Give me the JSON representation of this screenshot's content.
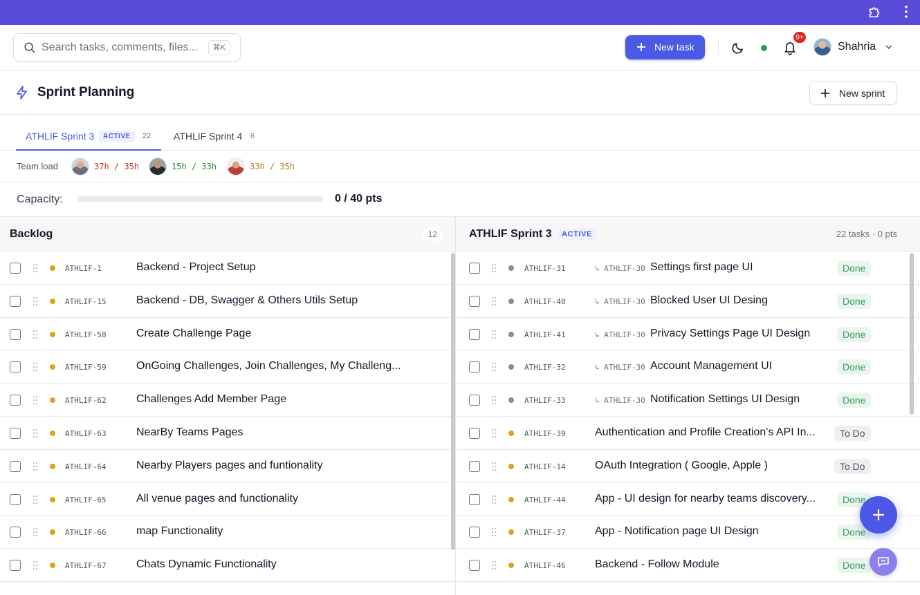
{
  "header": {
    "search_placeholder": "Search tasks, comments, files...",
    "search_shortcut": "⌘K",
    "new_task_label": "New task",
    "notifications_badge": "9+",
    "user_name": "Shahria"
  },
  "page": {
    "title": "Sprint Planning",
    "new_sprint_label": "New sprint"
  },
  "tabs": [
    {
      "label": "ATHLIF Sprint 3",
      "badge": "ACTIVE",
      "count": "22"
    },
    {
      "label": "ATHLIF Sprint 4",
      "count": "6"
    }
  ],
  "team_load": {
    "label": "Team load",
    "members": [
      {
        "load": "37h / 35h",
        "color": "#c0392b"
      },
      {
        "load": "15h / 33h",
        "color": "#2e8b3e"
      },
      {
        "load": "33h / 35h",
        "color": "#b7791f"
      }
    ]
  },
  "capacity": {
    "label": "Capacity:",
    "value": "0 / 40 pts",
    "fill_fraction": 0
  },
  "backlog": {
    "title": "Backlog",
    "count": "12",
    "rows": [
      {
        "id": "ATHLIF-1",
        "title": "Backend - Project Setup"
      },
      {
        "id": "ATHLIF-15",
        "title": "Backend - DB, Swagger & Others Utils Setup"
      },
      {
        "id": "ATHLIF-58",
        "title": "Create Challenge Page"
      },
      {
        "id": "ATHLIF-59",
        "title": "OnGoing Challenges, Join Challenges, My Challeng..."
      },
      {
        "id": "ATHLIF-62",
        "title": "Challenges Add Member Page"
      },
      {
        "id": "ATHLIF-63",
        "title": "NearBy Teams Pages"
      },
      {
        "id": "ATHLIF-64",
        "title": "Nearby Players pages and funtionality"
      },
      {
        "id": "ATHLIF-65",
        "title": "All venue pages and functionality"
      },
      {
        "id": "ATHLIF-66",
        "title": "map Functionality"
      },
      {
        "id": "ATHLIF-67",
        "title": "Chats Dynamic Functionality"
      }
    ]
  },
  "sprint": {
    "title": "ATHLIF Sprint 3",
    "badge": "ACTIVE",
    "meta": "22 tasks · 0 pts",
    "rows": [
      {
        "id": "ATHLIF-31",
        "parent": "↳ ATHLIF-30",
        "title": "Settings first page UI",
        "status": "Done",
        "dot": "#8a8d93"
      },
      {
        "id": "ATHLIF-40",
        "parent": "↳ ATHLIF-30",
        "title": "Blocked User UI Desing",
        "status": "Done",
        "dot": "#8a8d93"
      },
      {
        "id": "ATHLIF-41",
        "parent": "↳ ATHLIF-30",
        "title": "Privacy Settings Page UI Design",
        "status": "Done",
        "dot": "#8a8d93"
      },
      {
        "id": "ATHLIF-32",
        "parent": "↳ ATHLIF-30",
        "title": "Account Management UI",
        "status": "Done",
        "dot": "#8a8d93"
      },
      {
        "id": "ATHLIF-33",
        "parent": "↳ ATHLIF-30",
        "title": "Notification Settings UI Design",
        "status": "Done",
        "dot": "#8a8d93"
      },
      {
        "id": "ATHLIF-39",
        "parent": "",
        "title": "Authentication and Profile Creation's API In...",
        "status": "To Do",
        "dot": "#e0a021"
      },
      {
        "id": "ATHLIF-14",
        "parent": "",
        "title": "OAuth Integration ( Google, Apple )",
        "status": "To Do",
        "dot": "#e0a021"
      },
      {
        "id": "ATHLIF-44",
        "parent": "",
        "title": "App - UI design for nearby teams discovery...",
        "status": "Done",
        "dot": "#e0a021"
      },
      {
        "id": "ATHLIF-37",
        "parent": "",
        "title": "App - Notification page UI Design",
        "status": "Done",
        "dot": "#e0a021"
      },
      {
        "id": "ATHLIF-46",
        "parent": "",
        "title": "Backend - Follow Module",
        "status": "Done",
        "dot": "#e0a021"
      }
    ]
  },
  "colors": {
    "accent": "#4b5ae4",
    "topbar": "#5b4bdb",
    "priority_orange": "#e0a021"
  }
}
